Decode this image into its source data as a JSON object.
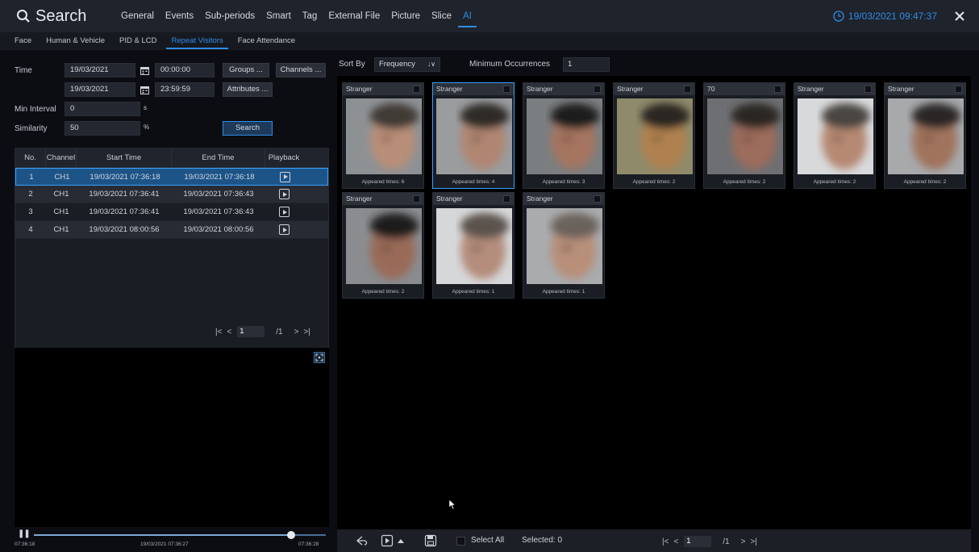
{
  "header": {
    "title": "Search",
    "tabs": [
      "General",
      "Events",
      "Sub-periods",
      "Smart",
      "Tag",
      "External File",
      "Picture",
      "Slice",
      "AI"
    ],
    "active_tab": "AI",
    "datetime": "19/03/2021 09:47:37",
    "accent": "#2f8ce6"
  },
  "subtabs": {
    "items": [
      "Face",
      "Human & Vehicle",
      "PID & LCD",
      "Repeat Visitors",
      "Face Attendance"
    ],
    "active": "Repeat Visitors"
  },
  "filters": {
    "time_label": "Time",
    "start_date": "19/03/2021",
    "start_time": "00:00:00",
    "end_date": "19/03/2021",
    "end_time": "23:59:59",
    "groups_btn": "Groups ...",
    "channels_btn": "Channels ...",
    "attributes_btn": "Attributes ...",
    "min_interval_label": "Min Interval",
    "min_interval_value": "0",
    "min_interval_unit": "s",
    "similarity_label": "Similarity",
    "similarity_value": "50",
    "similarity_unit": "%",
    "search_btn": "Search"
  },
  "table": {
    "headers": [
      "No.",
      "Channel",
      "Start Time",
      "End Time",
      "Playback"
    ],
    "rows": [
      {
        "no": "1",
        "channel": "CH1",
        "start": "19/03/2021 07:36:18",
        "end": "19/03/2021 07:36:18"
      },
      {
        "no": "2",
        "channel": "CH1",
        "start": "19/03/2021 07:36:41",
        "end": "19/03/2021 07:36:43"
      },
      {
        "no": "3",
        "channel": "CH1",
        "start": "19/03/2021 07:36:41",
        "end": "19/03/2021 07:36:43"
      },
      {
        "no": "4",
        "channel": "CH1",
        "start": "19/03/2021 08:00:56",
        "end": "19/03/2021 08:00:56"
      }
    ],
    "selected_row": 0
  },
  "left_pager": {
    "page": "1",
    "total": "/1"
  },
  "timeline": {
    "start": "07:36:18",
    "current": "19/03/2021 07:36:27",
    "end": "07:36:28",
    "progress": 0.88
  },
  "gallery_controls": {
    "sort_label": "Sort By",
    "sort_value": "Frequency",
    "min_occ_label": "Minimum Occurrences",
    "min_occ_value": "1"
  },
  "cards": [
    {
      "label": "Stranger",
      "footer": "Appeared times: 6",
      "selected": false,
      "bg": "#8e9194",
      "skin": "#b98e78",
      "hair": "#3f3a36"
    },
    {
      "label": "Stranger",
      "footer": "Appeared times: 4",
      "selected": true,
      "bg": "#9a9c9e",
      "skin": "#b08672",
      "hair": "#2e2a28"
    },
    {
      "label": "Stranger",
      "footer": "Appeared times: 3",
      "selected": false,
      "bg": "#7b7e80",
      "skin": "#a57561",
      "hair": "#1f1c1b"
    },
    {
      "label": "Stranger",
      "footer": "Appeared times: 2",
      "selected": false,
      "bg": "#8f8a6a",
      "skin": "#b0814f",
      "hair": "#2a2622"
    },
    {
      "label": "70",
      "footer": "Appeared times: 2",
      "selected": false,
      "bg": "#6e6f72",
      "skin": "#9c6c5c",
      "hair": "#2a2522"
    },
    {
      "label": "Stranger",
      "footer": "Appeared times: 2",
      "selected": false,
      "bg": "#d8d9db",
      "skin": "#b68973",
      "hair": "#4a4440"
    },
    {
      "label": "Stranger",
      "footer": "Appeared times: 2",
      "selected": false,
      "bg": "#a7a9ab",
      "skin": "#a0735d",
      "hair": "#2b2725"
    },
    {
      "label": "Stranger",
      "footer": "Appeared times: 2",
      "selected": false,
      "bg": "#8a8c8f",
      "skin": "#9a6a58",
      "hair": "#1f1b1a"
    },
    {
      "label": "Stranger",
      "footer": "Appeared times: 1",
      "selected": false,
      "bg": "#d6d7d9",
      "skin": "#b48d7b",
      "hair": "#5c534d"
    },
    {
      "label": "Stranger",
      "footer": "Appeared times: 1",
      "selected": false,
      "bg": "#a9abad",
      "skin": "#b88f79",
      "hair": "#6b625b"
    }
  ],
  "bottombar": {
    "select_all": "Select All",
    "selected": "Selected: 0",
    "page": "1",
    "total": "/1"
  },
  "icons": [
    "search-icon",
    "clock-icon",
    "close-icon",
    "calendar-icon",
    "play-icon",
    "fullscreen-icon",
    "back-icon",
    "save-icon"
  ]
}
